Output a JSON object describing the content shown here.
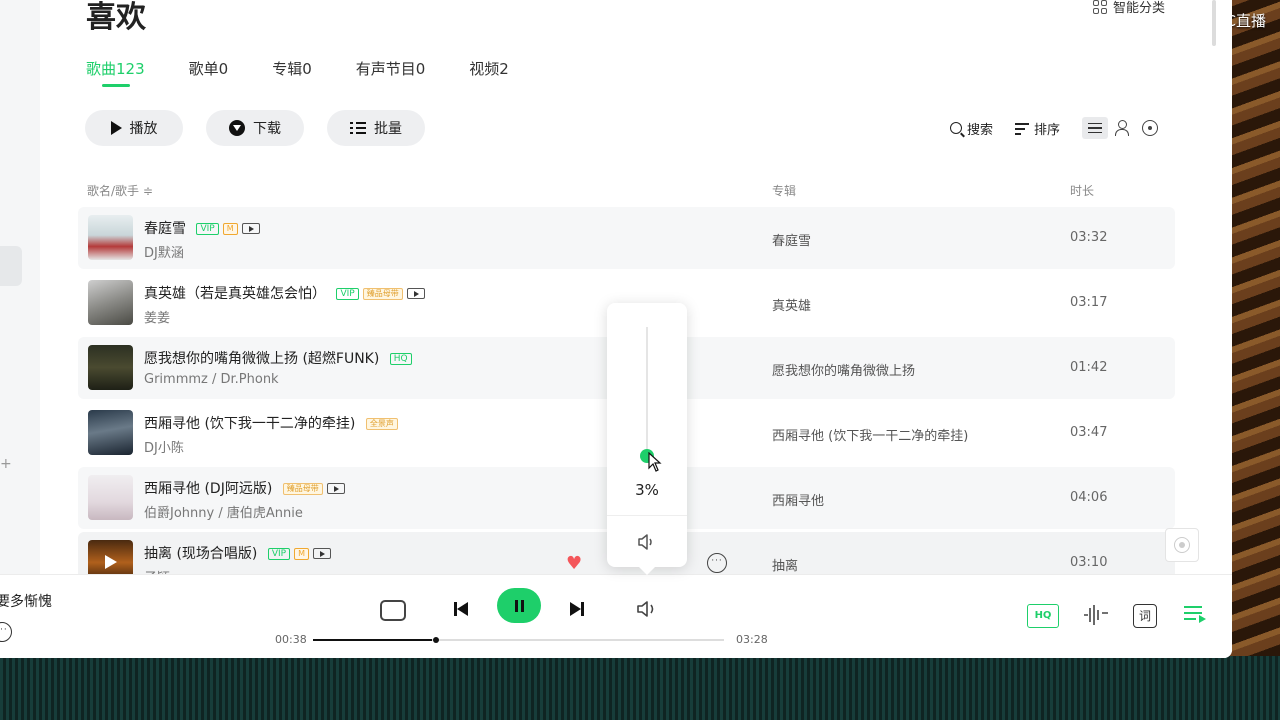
{
  "page": {
    "title": "喜欢",
    "smart_category": "智能分类"
  },
  "watermark": "CC直播",
  "tabs": [
    {
      "label": "歌曲123",
      "active": true
    },
    {
      "label": "歌单0",
      "active": false
    },
    {
      "label": "专辑0",
      "active": false
    },
    {
      "label": "有声节目0",
      "active": false
    },
    {
      "label": "视频2",
      "active": false
    }
  ],
  "actions": {
    "play": "播放",
    "download": "下载",
    "batch": "批量"
  },
  "toolbar": {
    "search": "搜索",
    "sort": "排序"
  },
  "columns": {
    "song": "歌名/歌手 ≑",
    "album": "专辑",
    "duration": "时长"
  },
  "songs": [
    {
      "title": "春庭雪",
      "artist": "DJ默涵",
      "album": "春庭雪",
      "duration": "03:32"
    },
    {
      "title": "真英雄（若是真英雄怎会怕）",
      "artist": "姜姜",
      "album": "真英雄",
      "duration": "03:17"
    },
    {
      "title": "愿我想你的嘴角微微上扬 (超燃FUNK)",
      "artist": "Grimmmz / Dr.Phonk",
      "album": "愿我想你的嘴角微微上扬",
      "duration": "01:42"
    },
    {
      "title": "西厢寻他 (饮下我一干二净的牵挂)",
      "artist": "DJ小陈",
      "album": "西厢寻他 (饮下我一干二净的牵挂)",
      "duration": "03:47"
    },
    {
      "title": "西厢寻他 (DJ阿远版)",
      "artist": "伯爵Johnny / 唐伯虎Annie",
      "album": "西厢寻他",
      "duration": "04:06"
    },
    {
      "title": "抽离 (现场合唱版)",
      "artist": "子颖",
      "album": "抽离",
      "duration": "03:10"
    }
  ],
  "badges": {
    "vip": "VIP",
    "m": "M",
    "hq": "HQ",
    "premium": "臻品母带",
    "full": "全景声"
  },
  "player": {
    "now_playing": "要多惭愧",
    "elapsed": "00:38",
    "total": "03:28",
    "progress": 0.29,
    "hq": "HQ",
    "lyrics": "词"
  },
  "volume": {
    "percent": "3%",
    "level": 0.03
  },
  "colors": {
    "accent": "#1ecf6a",
    "heart": "#f4565a"
  }
}
